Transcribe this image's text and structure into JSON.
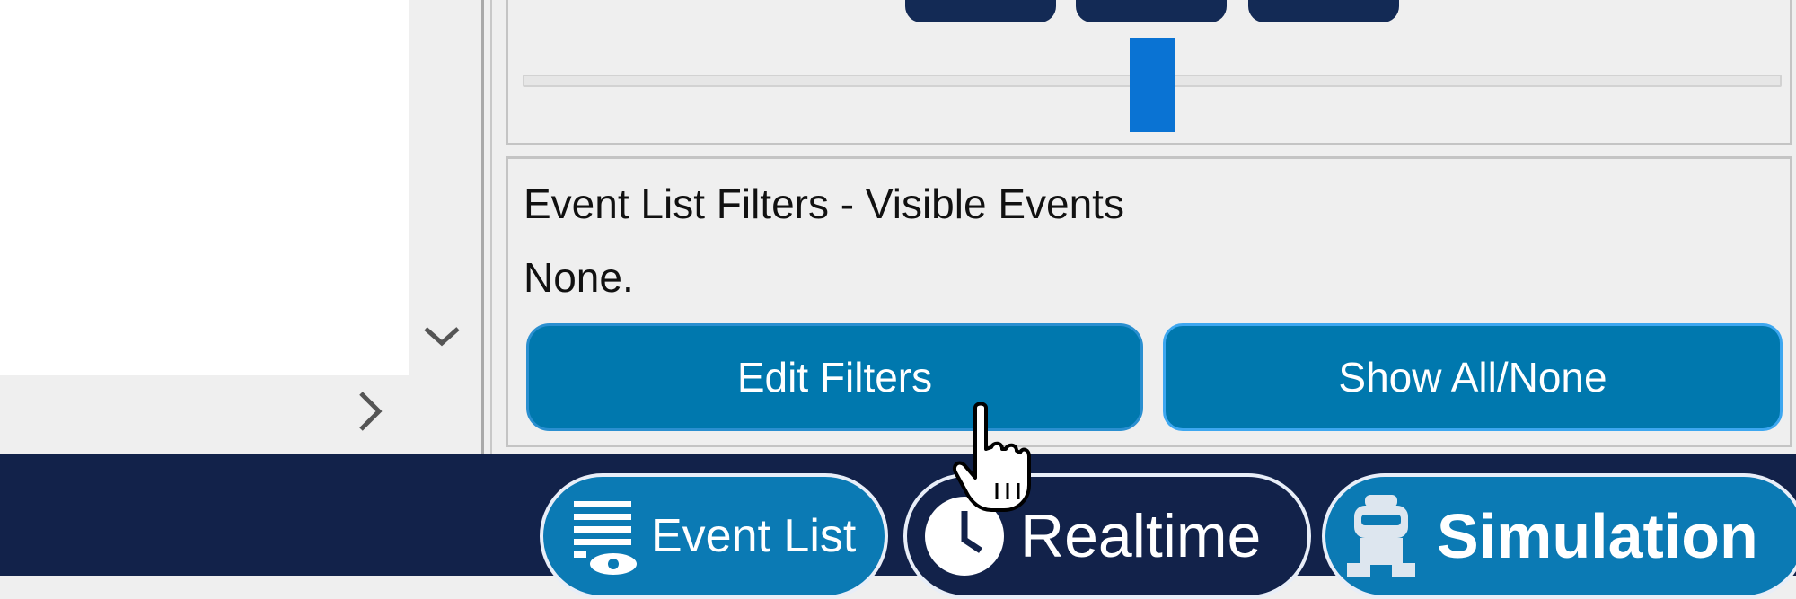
{
  "filters": {
    "title": "Event List Filters - Visible Events",
    "value": "None.",
    "edit_label": "Edit Filters",
    "show_label": "Show All/None"
  },
  "tabs": {
    "event_list": "Event List",
    "realtime": "Realtime",
    "simulation": "Simulation"
  },
  "icons": {
    "scroll_down": "chevron-down-icon",
    "scroll_right": "chevron-right-icon",
    "event_list": "list-eye-icon",
    "realtime": "clock-icon",
    "simulation": "robot-icon",
    "cursor": "hand-pointer-icon"
  },
  "colors": {
    "accent": "#0078ae",
    "navy": "#12224a",
    "slider_thumb": "#0a73d3"
  }
}
